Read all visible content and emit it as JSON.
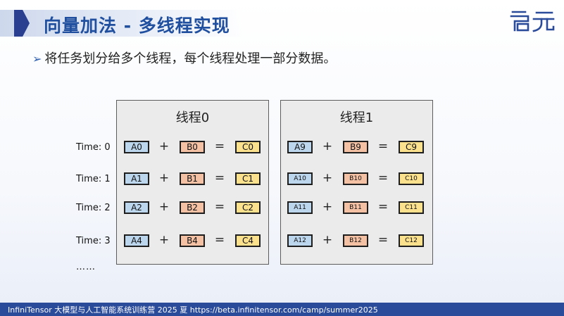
{
  "title": "向量加法 - 多线程实现",
  "bullet": "将任务划分给多个线程，每个线程处理一部分数据。",
  "logo_text": "启元",
  "panels": [
    {
      "title": "线程0",
      "rows": [
        {
          "a": "A0",
          "b": "B0",
          "c": "C0"
        },
        {
          "a": "A1",
          "b": "B1",
          "c": "C1"
        },
        {
          "a": "A2",
          "b": "B2",
          "c": "C2"
        },
        {
          "a": "A4",
          "b": "B4",
          "c": "C4"
        }
      ]
    },
    {
      "title": "线程1",
      "rows": [
        {
          "a": "A9",
          "b": "B9",
          "c": "C9"
        },
        {
          "a": "A10",
          "b": "B10",
          "c": "C10"
        },
        {
          "a": "A11",
          "b": "B11",
          "c": "C11"
        },
        {
          "a": "A12",
          "b": "B12",
          "c": "C12"
        }
      ]
    }
  ],
  "times": [
    "Time: 0",
    "Time: 1",
    "Time: 2",
    "Time: 3"
  ],
  "plus": "+",
  "equals": "=",
  "ellipsis": "……",
  "footer": "InfiniTensor 大模型与人工智能系统训练营 2025 夏    https://beta.infinitensor.com/camp/summer2025",
  "colors": {
    "a_cell": "#bcd6ee",
    "b_cell": "#f4c1a4",
    "c_cell": "#fbe08e",
    "accent": "#1f4f9e",
    "footer_bg": "#2a4a9a"
  }
}
